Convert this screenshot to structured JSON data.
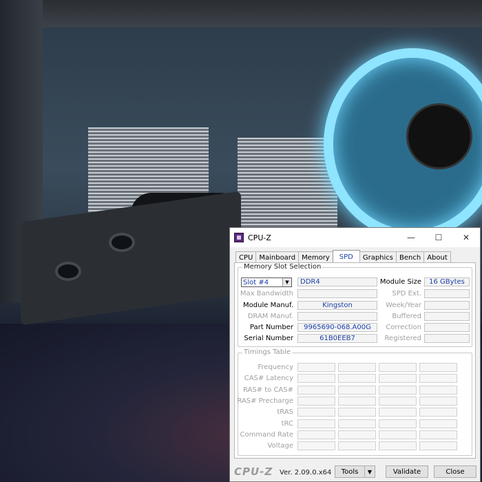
{
  "window": {
    "title": "CPU-Z"
  },
  "tabs": [
    {
      "label": "CPU"
    },
    {
      "label": "Mainboard"
    },
    {
      "label": "Memory"
    },
    {
      "label": "SPD",
      "active": true
    },
    {
      "label": "Graphics"
    },
    {
      "label": "Bench"
    },
    {
      "label": "About"
    }
  ],
  "memory_slot": {
    "group_label": "Memory Slot Selection",
    "slot_selected": "Slot #4",
    "memory_type": "DDR4",
    "module_size_label": "Module Size",
    "module_size": "16 GBytes",
    "max_bandwidth_label": "Max Bandwidth",
    "max_bandwidth": "",
    "spd_ext_label": "SPD Ext.",
    "spd_ext": "",
    "module_manuf_label": "Module Manuf.",
    "module_manuf": "Kingston",
    "week_year_label": "Week/Year",
    "week_year": "",
    "dram_manuf_label": "DRAM Manuf.",
    "dram_manuf": "",
    "buffered_label": "Buffered",
    "buffered": "",
    "part_number_label": "Part Number",
    "part_number": "9965690-068.A00G",
    "correction_label": "Correction",
    "correction": "",
    "serial_number_label": "Serial Number",
    "serial_number": "61B0EEB7",
    "registered_label": "Registered",
    "registered": ""
  },
  "timings": {
    "group_label": "Timings Table",
    "rows": [
      "Frequency",
      "CAS# Latency",
      "RAS# to CAS#",
      "RAS# Precharge",
      "tRAS",
      "tRC",
      "Command Rate",
      "Voltage"
    ]
  },
  "footer": {
    "brand": "CPU-Z",
    "version": "Ver. 2.09.0.x64",
    "tools_label": "Tools",
    "validate_label": "Validate",
    "close_label": "Close"
  },
  "icons": {
    "minimize": "minimize-icon",
    "maximize": "maximize-icon",
    "close": "close-icon",
    "dropdown": "chevron-down-icon"
  },
  "colors": {
    "value_text": "#1a3fa8",
    "fan_glow": "#8fe4ff"
  }
}
